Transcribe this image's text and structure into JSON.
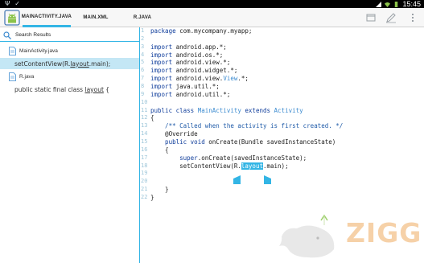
{
  "status_bar": {
    "time": "15:45"
  },
  "action_bar": {
    "tabs": [
      {
        "label": "MAINACTIVITY.JAVA",
        "active": true
      },
      {
        "label": "MAIN.XML",
        "active": false
      },
      {
        "label": "R.JAVA",
        "active": false
      }
    ],
    "accent_color": "#33b5e5"
  },
  "sidebar": {
    "search_label": "Search Results",
    "groups": [
      {
        "file": "MainActivity.java",
        "results": [
          {
            "prefix": "setContentView(R.",
            "match": "layout",
            "suffix": ".main);"
          }
        ]
      },
      {
        "file": "R.java",
        "results": [
          {
            "prefix": "public static final class ",
            "match": "layout",
            "suffix": " {"
          }
        ]
      }
    ]
  },
  "editor": {
    "line_numbers": [
      "1",
      "2",
      "3",
      "4",
      "5",
      "6",
      "7",
      "8",
      "9",
      "10",
      "11",
      "12",
      "13",
      "14",
      "15",
      "16",
      "17",
      "18",
      "19",
      "20",
      "21",
      "22"
    ],
    "lines": {
      "l1_kw": "package",
      "l1_rest": " com.mycompany.myapp;",
      "l3_kw": "import",
      "l3_rest": " android.app.*;",
      "l4_kw": "import",
      "l4_rest": " android.os.*;",
      "l5_kw": "import",
      "l5_rest": " android.view.*;",
      "l6_kw": "import",
      "l6_rest": " android.widget.*;",
      "l7_kw": "import",
      "l7_a": " android.view.",
      "l7_ty": "View",
      "l7_b": ".*;",
      "l8_kw": "import",
      "l8_rest": " java.util.*;",
      "l9_kw": "import",
      "l9_rest": " android.util.*;",
      "l11_kw1": "public class",
      "l11_name": " MainActivity ",
      "l11_kw2": "extends",
      "l11_ty": " Activity",
      "l12": "{",
      "l13": "    /** Called when the activity is first created. */",
      "l14": "    @Override",
      "l15_kw": "    public void",
      "l15_rest": " onCreate(Bundle savedInstanceState)",
      "l16": "    {",
      "l17_kw": "        super",
      "l17_rest": ".onCreate(savedInstanceState);",
      "l18_a": "        setContentView(R.",
      "l18_hl": "layout",
      "l18_b": ".main);",
      "l21": "    }",
      "l22": "}"
    }
  }
}
